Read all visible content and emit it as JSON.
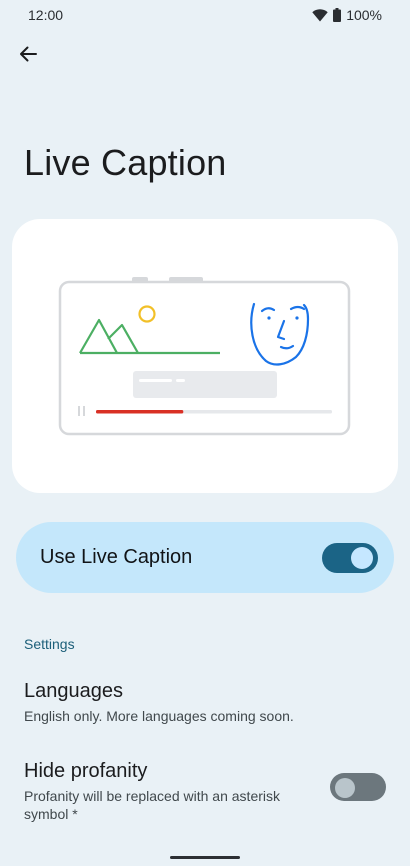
{
  "status_bar": {
    "time": "12:00",
    "battery": "100%",
    "icons": [
      "wifi-icon",
      "battery-icon"
    ]
  },
  "header": {
    "back_icon": "arrow-back-icon",
    "title": "Live Caption"
  },
  "illustration": {
    "icons": [
      "mountains-icon",
      "sun-icon",
      "face-icon",
      "pause-icon"
    ],
    "progress": 0.37,
    "colors": {
      "mountains": "#4caf63",
      "sun": "#f2c028",
      "face": "#1a73e8",
      "progress": "#d93025"
    }
  },
  "main_toggle": {
    "label": "Use Live Caption",
    "state": "on"
  },
  "settings": {
    "header": "Settings",
    "items": [
      {
        "title": "Languages",
        "summary": "English only. More languages coming soon."
      },
      {
        "title": "Hide profanity",
        "summary": "Profanity will be replaced with an asterisk symbol *",
        "toggle_state": "off"
      }
    ]
  },
  "colors": {
    "background": "#e9f1f6",
    "toggle_card": "#c4e7fb",
    "accent": "#1b6486",
    "section_header": "#1c5f79"
  }
}
